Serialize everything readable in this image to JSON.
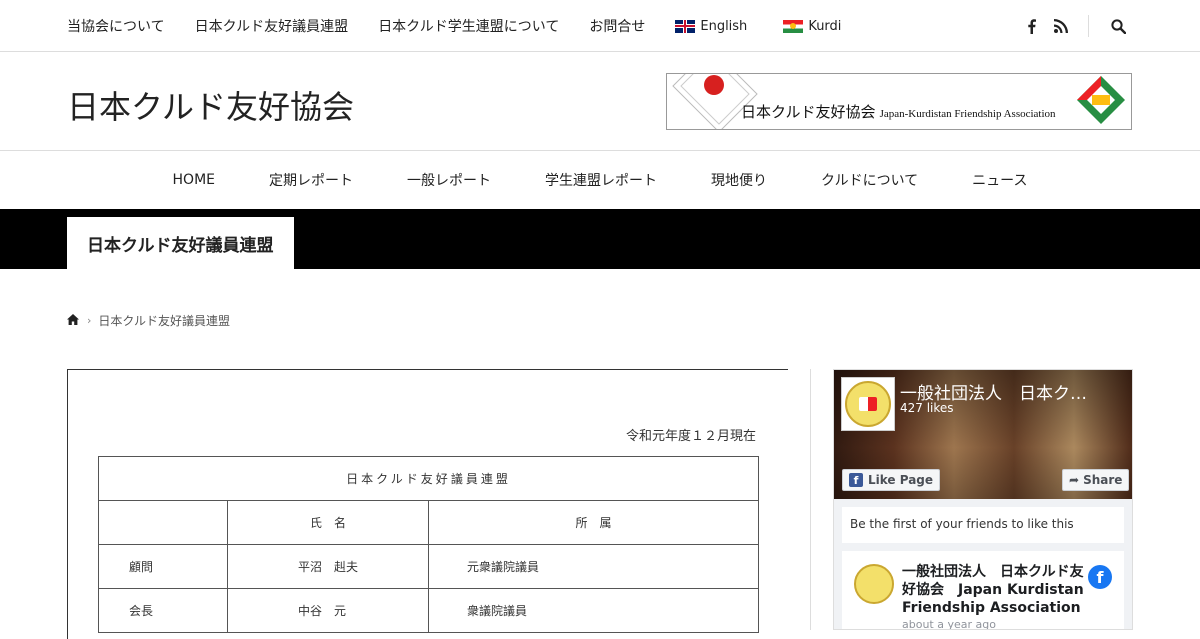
{
  "topnav": {
    "items": [
      "当協会について",
      "日本クルド友好議員連盟",
      "日本クルド学生連盟について",
      "お問合せ"
    ],
    "languages": [
      {
        "label": "English",
        "flag": "uk-flag-icon"
      },
      {
        "label": "Kurdi",
        "flag": "kurdistan-flag-icon"
      }
    ],
    "icons": [
      "facebook-icon",
      "rss-icon",
      "search-icon"
    ]
  },
  "header": {
    "site_title": "日本クルド友好協会",
    "banner": {
      "title_ja": "日本クルド友好協会",
      "title_en": "Japan-Kurdistan Friendship Association"
    }
  },
  "mainnav": {
    "items": [
      "HOME",
      "定期レポート",
      "一般レポート",
      "学生連盟レポート",
      "現地便り",
      "クルドについて",
      "ニュース"
    ]
  },
  "page": {
    "title": "日本クルド友好議員連盟",
    "breadcrumb": {
      "current": "日本クルド友好議員連盟"
    }
  },
  "document": {
    "date": "令和元年度１２月現在",
    "caption": "日本クルド友好議員連盟",
    "headers": [
      "",
      "氏　名",
      "所　属"
    ],
    "rows": [
      [
        "顧問",
        "平沼　赳夫",
        "元衆議院議員"
      ],
      [
        "会長",
        "中谷　元",
        "衆議院議員"
      ]
    ]
  },
  "facebook": {
    "page_name": "一般社団法人　日本ク…",
    "likes": "427 likes",
    "like_label": "Like Page",
    "share_label": "Share",
    "friends_text": "Be the first of your friends to like this",
    "post_author": "一般社団法人　日本クルド友好協会　Japan Kurdistan Friendship Association",
    "post_time": "about a year ago"
  },
  "colors": {
    "band": "#000000",
    "facebook_blue": "#1877f2",
    "kurdistan_red": "#ed2024",
    "kurdistan_green": "#278e43",
    "japan_red": "#d7201f"
  }
}
